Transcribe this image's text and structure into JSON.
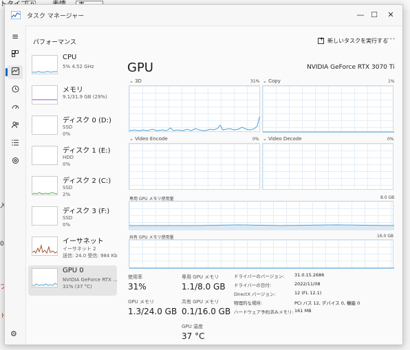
{
  "background": {
    "menu_text_1": "トタイプ",
    "menu_box_1": "P",
    "menu_text_2": "表情",
    "menu_box_2": "表",
    "edge_chars": [
      "入",
      "0",
      "ブ",
      "ト"
    ]
  },
  "window": {
    "title": "タスク マネージャー",
    "controls": {
      "minimize": "—",
      "maximize": "☐",
      "close": "✕"
    }
  },
  "nav": {
    "hamburger": "≡",
    "items": [
      "processes",
      "performance",
      "app-history",
      "startup",
      "users",
      "details",
      "services"
    ],
    "settings": "⚙"
  },
  "header": {
    "page_title": "パフォーマンス",
    "run_task_label": "新しいタスクを実行する",
    "more": "···"
  },
  "devices": [
    {
      "name": "CPU",
      "line1": "5% 4.52 GHz",
      "line2": "",
      "line3": ""
    },
    {
      "name": "メモリ",
      "line1": "9.1/31.9 GB (29%)",
      "line2": "",
      "line3": ""
    },
    {
      "name": "ディスク 0 (D:)",
      "line1": "SSD",
      "line2": "0%",
      "line3": ""
    },
    {
      "name": "ディスク 1 (E:)",
      "line1": "HDD",
      "line2": "0%",
      "line3": ""
    },
    {
      "name": "ディスク 2 (C:)",
      "line1": "SSD",
      "line2": "2%",
      "line3": ""
    },
    {
      "name": "ディスク 3 (F:)",
      "line1": "SSD",
      "line2": "0%",
      "line3": ""
    },
    {
      "name": "イーサネット",
      "line1": "イーサネット 2",
      "line2": "送信: 24.0 受信: 984 Kb",
      "line3": ""
    },
    {
      "name": "GPU 0",
      "line1": "NVIDIA GeForce RTX ...",
      "line2": "31% (37 °C)",
      "line3": ""
    }
  ],
  "selected_device": 7,
  "gpu": {
    "title": "GPU",
    "model": "NVIDIA GeForce RTX 3070 Ti",
    "engines": [
      {
        "name": "3D",
        "pct": "31%"
      },
      {
        "name": "Copy",
        "pct": "1%"
      },
      {
        "name": "Video Encode",
        "pct": "0%"
      },
      {
        "name": "Video Decode",
        "pct": "0%"
      }
    ],
    "dedicated_mem": {
      "label": "専用 GPU メモリ使用量",
      "max": "8.0 GB"
    },
    "shared_mem": {
      "label": "共有 GPU メモリ使用量",
      "max": "16.0 GB"
    },
    "stats": {
      "usage_label": "使用率",
      "usage_value": "31%",
      "dedicated_label": "専用 GPU メモリ",
      "dedicated_value": "1.1/8.0 GB",
      "gpu_mem_label": "GPU メモリ",
      "gpu_mem_value": "1.3/24.0 GB",
      "shared_label": "共有 GPU メモリ",
      "shared_value": "0.1/16.0 GB",
      "temp_label": "GPU 温度",
      "temp_value": "37 °C"
    },
    "properties": [
      {
        "key": "ドライバーのバージョン:",
        "value": "31.0.15.2686"
      },
      {
        "key": "ドライバーの日付:",
        "value": "2022/11/08"
      },
      {
        "key": "DirectX バージョン:",
        "value": "12 (FL 12.1)"
      },
      {
        "key": "物理的な場所:",
        "value": "PCI バス 12, デバイス 0, 機能 0"
      },
      {
        "key": "ハードウェア予約済みメモリ:",
        "value": "161 MB"
      }
    ]
  },
  "colors": {
    "accent": "#0067c0",
    "graph_line": "#4a9fd8",
    "memory_line": "#9b4fc0",
    "disk_line": "#4caf50",
    "net_line": "#a0522d"
  }
}
